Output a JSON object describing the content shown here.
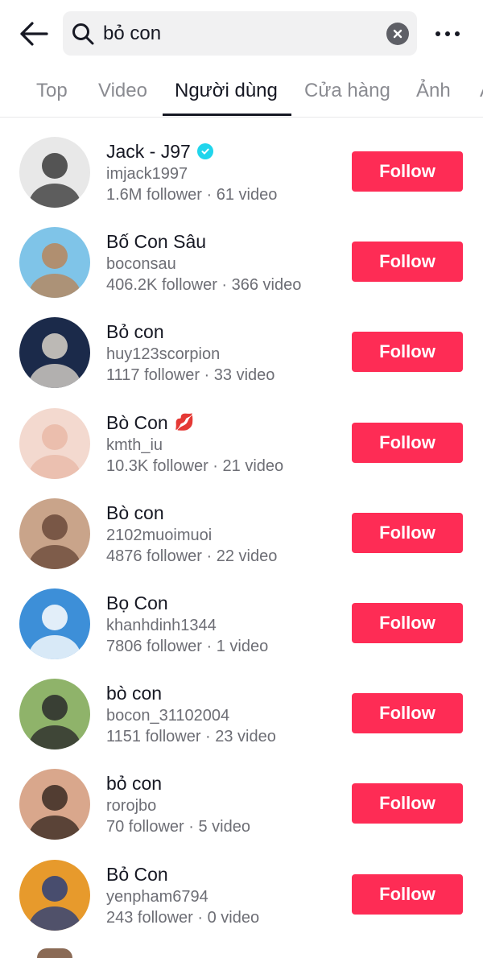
{
  "search": {
    "query": "bỏ con"
  },
  "tabs": [
    {
      "label": "Top"
    },
    {
      "label": "Video"
    },
    {
      "label": "Người dùng",
      "active": true
    },
    {
      "label": "Cửa hàng"
    },
    {
      "label": "Ảnh"
    },
    {
      "label": "Â"
    }
  ],
  "users": [
    {
      "name": "Jack - J97",
      "verified": true,
      "handle": "imjack1997",
      "stats": "1.6M follower · 61 video",
      "follow_label": "Follow",
      "avatar_colors": [
        "#e8e8e8",
        "#3a3a3a"
      ]
    },
    {
      "name": "Bố Con Sâu",
      "handle": "boconsau",
      "stats": "406.2K follower · 366 video",
      "follow_label": "Follow",
      "avatar_colors": [
        "#7fc4e8",
        "#b8865a"
      ]
    },
    {
      "name": "Bỏ con",
      "handle": "huy123scorpion",
      "stats": "1117 follower · 33 video",
      "follow_label": "Follow",
      "avatar_colors": [
        "#1b2a4a",
        "#d8d2c8"
      ]
    },
    {
      "name": "Bò Con",
      "emoji": "💋",
      "handle": "kmth_iu",
      "stats": "10.3K follower · 21 video",
      "follow_label": "Follow",
      "avatar_colors": [
        "#f3d9cf",
        "#e9b9a7"
      ]
    },
    {
      "name": "Bò con",
      "handle": "2102muoimuoi",
      "stats": "4876 follower · 22 video",
      "follow_label": "Follow",
      "avatar_colors": [
        "#c9a48a",
        "#6b4a3a"
      ]
    },
    {
      "name": "Bọ Con",
      "handle": "khanhdinh1344",
      "stats": "7806 follower · 1 video",
      "follow_label": "Follow",
      "avatar_colors": [
        "#3d8fd8",
        "#ffffff"
      ]
    },
    {
      "name": "bò con",
      "handle": "bocon_31102004",
      "stats": "1151 follower · 23 video",
      "follow_label": "Follow",
      "avatar_colors": [
        "#8fb36a",
        "#2a2a2a"
      ]
    },
    {
      "name": "bỏ con",
      "handle": "rorojbo",
      "stats": "70 follower · 5 video",
      "follow_label": "Follow",
      "avatar_colors": [
        "#d9a78c",
        "#3a2a22"
      ]
    },
    {
      "name": "Bỏ Con",
      "handle": "yenpham6794",
      "stats": "243 follower · 0 video",
      "follow_label": "Follow",
      "avatar_colors": [
        "#e79a2c",
        "#2b3f7a"
      ]
    }
  ],
  "icons": {
    "back": "arrow-left-icon",
    "search": "search-icon",
    "clear": "clear-icon",
    "more": "more-icon",
    "verified": "verified-icon"
  },
  "colors": {
    "accent": "#fe2c55",
    "verified": "#20d5ec"
  }
}
